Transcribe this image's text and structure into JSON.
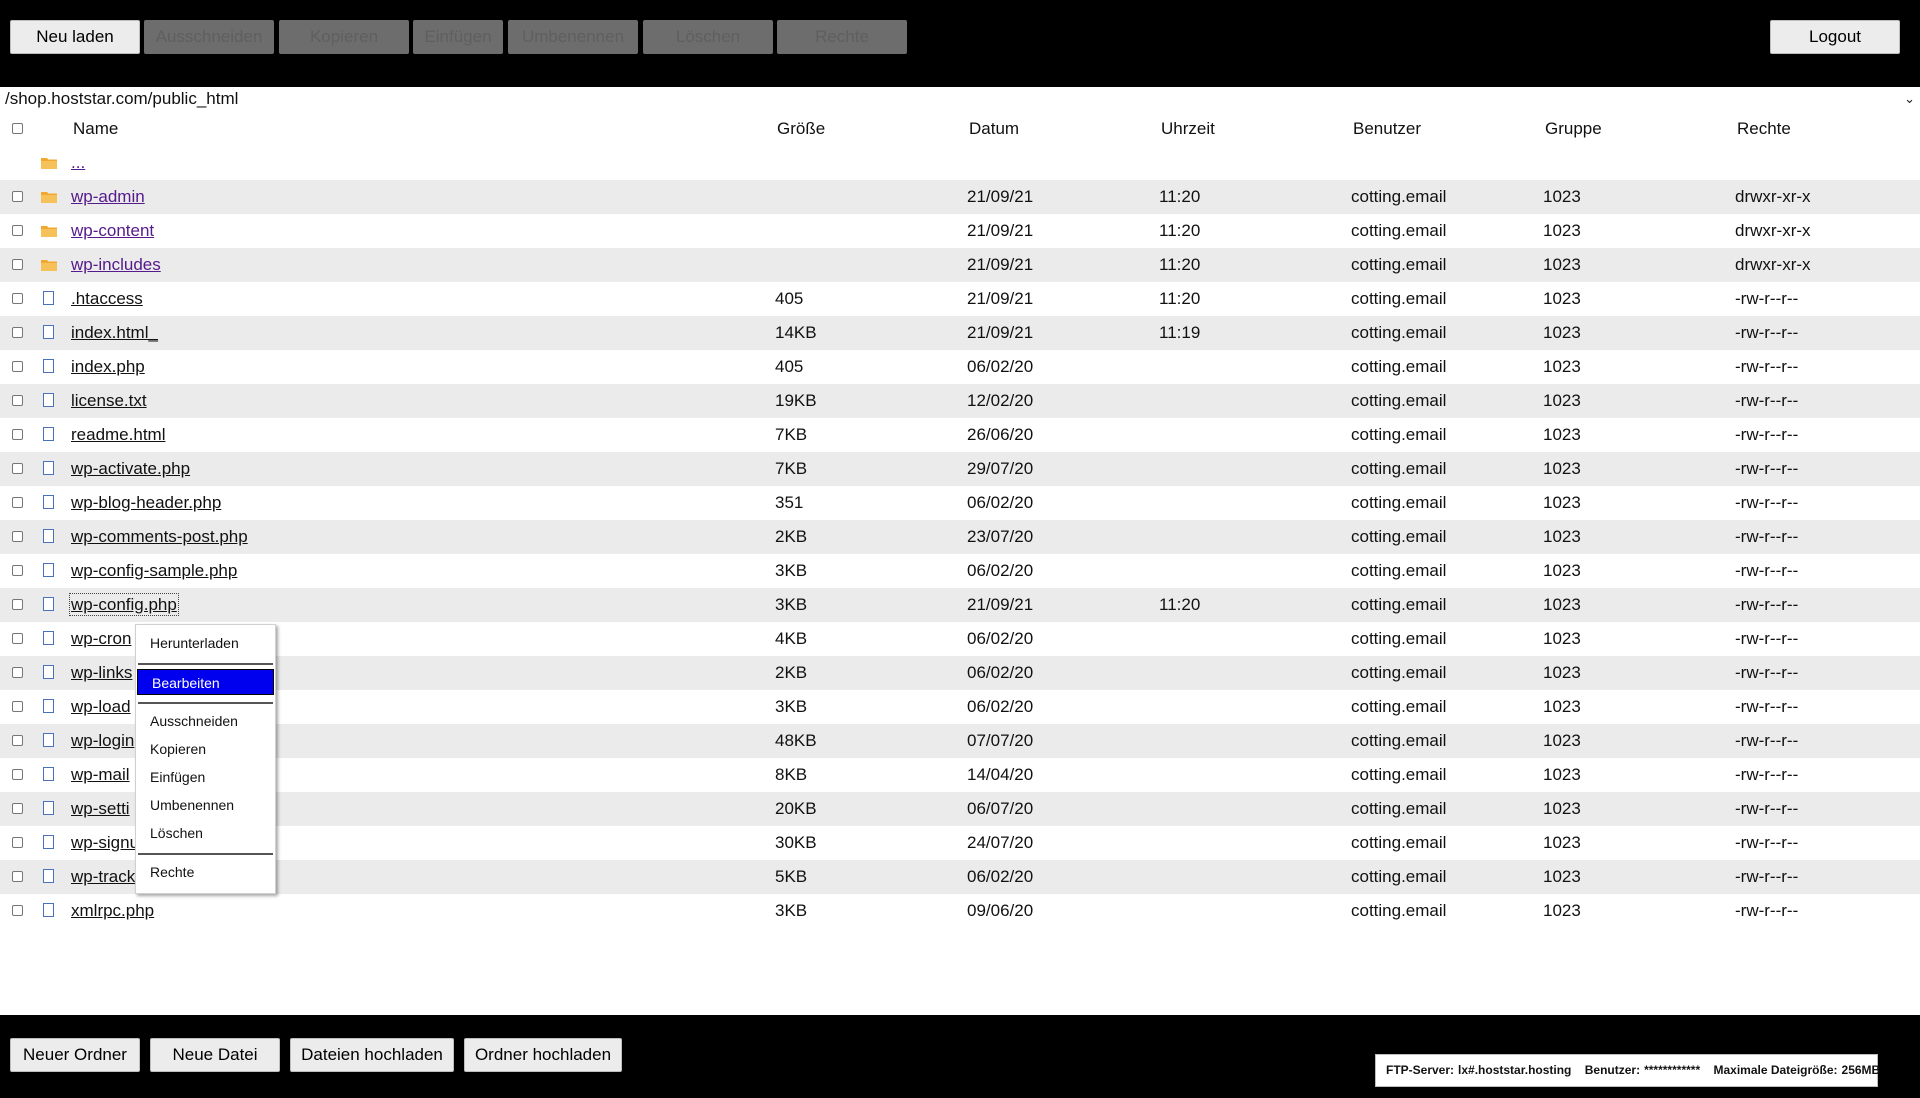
{
  "toolbar": {
    "reload": "Neu laden",
    "cut": "Ausschneiden",
    "copy": "Kopieren",
    "paste": "Einfügen",
    "rename": "Umbenennen",
    "delete": "Löschen",
    "permissions": "Rechte",
    "logout": "Logout"
  },
  "path": {
    "current": "/shop.hoststar.com/public_html"
  },
  "table": {
    "headers": {
      "name": "Name",
      "size": "Größe",
      "date": "Datum",
      "time": "Uhrzeit",
      "user": "Benutzer",
      "group": "Gruppe",
      "perms": "Rechte"
    },
    "parent": "...",
    "rows": [
      {
        "name": "wp-admin",
        "size": "",
        "date": "21/09/21",
        "time": "11:20",
        "user": "cotting.email",
        "group": "1023",
        "perms": "drwxr-xr-x"
      },
      {
        "name": "wp-content",
        "size": "",
        "date": "21/09/21",
        "time": "11:20",
        "user": "cotting.email",
        "group": "1023",
        "perms": "drwxr-xr-x"
      },
      {
        "name": "wp-includes",
        "size": "",
        "date": "21/09/21",
        "time": "11:20",
        "user": "cotting.email",
        "group": "1023",
        "perms": "drwxr-xr-x"
      },
      {
        "name": ".htaccess",
        "size": "405",
        "date": "21/09/21",
        "time": "11:20",
        "user": "cotting.email",
        "group": "1023",
        "perms": "-rw-r--r--"
      },
      {
        "name": "index.html_",
        "size": "14KB",
        "date": "21/09/21",
        "time": "11:19",
        "user": "cotting.email",
        "group": "1023",
        "perms": "-rw-r--r--"
      },
      {
        "name": "index.php",
        "size": "405",
        "date": "06/02/20",
        "time": "",
        "user": "cotting.email",
        "group": "1023",
        "perms": "-rw-r--r--"
      },
      {
        "name": "license.txt",
        "size": "19KB",
        "date": "12/02/20",
        "time": "",
        "user": "cotting.email",
        "group": "1023",
        "perms": "-rw-r--r--"
      },
      {
        "name": "readme.html",
        "size": "7KB",
        "date": "26/06/20",
        "time": "",
        "user": "cotting.email",
        "group": "1023",
        "perms": "-rw-r--r--"
      },
      {
        "name": "wp-activate.php",
        "size": "7KB",
        "date": "29/07/20",
        "time": "",
        "user": "cotting.email",
        "group": "1023",
        "perms": "-rw-r--r--"
      },
      {
        "name": "wp-blog-header.php",
        "size": "351",
        "date": "06/02/20",
        "time": "",
        "user": "cotting.email",
        "group": "1023",
        "perms": "-rw-r--r--"
      },
      {
        "name": "wp-comments-post.php",
        "size": "2KB",
        "date": "23/07/20",
        "time": "",
        "user": "cotting.email",
        "group": "1023",
        "perms": "-rw-r--r--"
      },
      {
        "name": "wp-config-sample.php",
        "size": "3KB",
        "date": "06/02/20",
        "time": "",
        "user": "cotting.email",
        "group": "1023",
        "perms": "-rw-r--r--"
      },
      {
        "name": "wp-config.php",
        "size": "3KB",
        "date": "21/09/21",
        "time": "11:20",
        "user": "cotting.email",
        "group": "1023",
        "perms": "-rw-r--r--"
      },
      {
        "name": "wp-cron",
        "size": "4KB",
        "date": "06/02/20",
        "time": "",
        "user": "cotting.email",
        "group": "1023",
        "perms": "-rw-r--r--"
      },
      {
        "name": "wp-links",
        "size": "2KB",
        "date": "06/02/20",
        "time": "",
        "user": "cotting.email",
        "group": "1023",
        "perms": "-rw-r--r--"
      },
      {
        "name": "wp-load",
        "size": "3KB",
        "date": "06/02/20",
        "time": "",
        "user": "cotting.email",
        "group": "1023",
        "perms": "-rw-r--r--"
      },
      {
        "name": "wp-login",
        "size": "48KB",
        "date": "07/07/20",
        "time": "",
        "user": "cotting.email",
        "group": "1023",
        "perms": "-rw-r--r--"
      },
      {
        "name": "wp-mail",
        "size": "8KB",
        "date": "14/04/20",
        "time": "",
        "user": "cotting.email",
        "group": "1023",
        "perms": "-rw-r--r--"
      },
      {
        "name": "wp-setti",
        "size": "20KB",
        "date": "06/07/20",
        "time": "",
        "user": "cotting.email",
        "group": "1023",
        "perms": "-rw-r--r--"
      },
      {
        "name": "wp-signu",
        "size": "30KB",
        "date": "24/07/20",
        "time": "",
        "user": "cotting.email",
        "group": "1023",
        "perms": "-rw-r--r--"
      },
      {
        "name": "wp-track",
        "size": "5KB",
        "date": "06/02/20",
        "time": "",
        "user": "cotting.email",
        "group": "1023",
        "perms": "-rw-r--r--"
      },
      {
        "name": "xmlrpc.php",
        "size": "3KB",
        "date": "09/06/20",
        "time": "",
        "user": "cotting.email",
        "group": "1023",
        "perms": "-rw-r--r--"
      }
    ]
  },
  "context_menu": {
    "download": "Herunterladen",
    "edit": "Bearbeiten",
    "cut": "Ausschneiden",
    "copy": "Kopieren",
    "paste": "Einfügen",
    "rename": "Umbenennen",
    "delete": "Löschen",
    "permissions": "Rechte"
  },
  "bottom": {
    "new_folder": "Neuer Ordner",
    "new_file": "Neue Datei",
    "upload_files": "Dateien hochladen",
    "upload_folder": "Ordner hochladen",
    "server_label": "FTP-Server:",
    "server_value": "lx#.hoststar.hosting",
    "user_label": "Benutzer:",
    "user_value": "************",
    "maxsize_label": "Maximale Dateigröße:",
    "maxsize_value": "256MB"
  },
  "colors": {
    "bar_bg": "#000000",
    "row_alt": "#ebebeb",
    "menu_active": "#0000ee",
    "folder_icon": "#f0a830",
    "file_icon": "#4a72b8",
    "visited_link": "#551a8b"
  }
}
